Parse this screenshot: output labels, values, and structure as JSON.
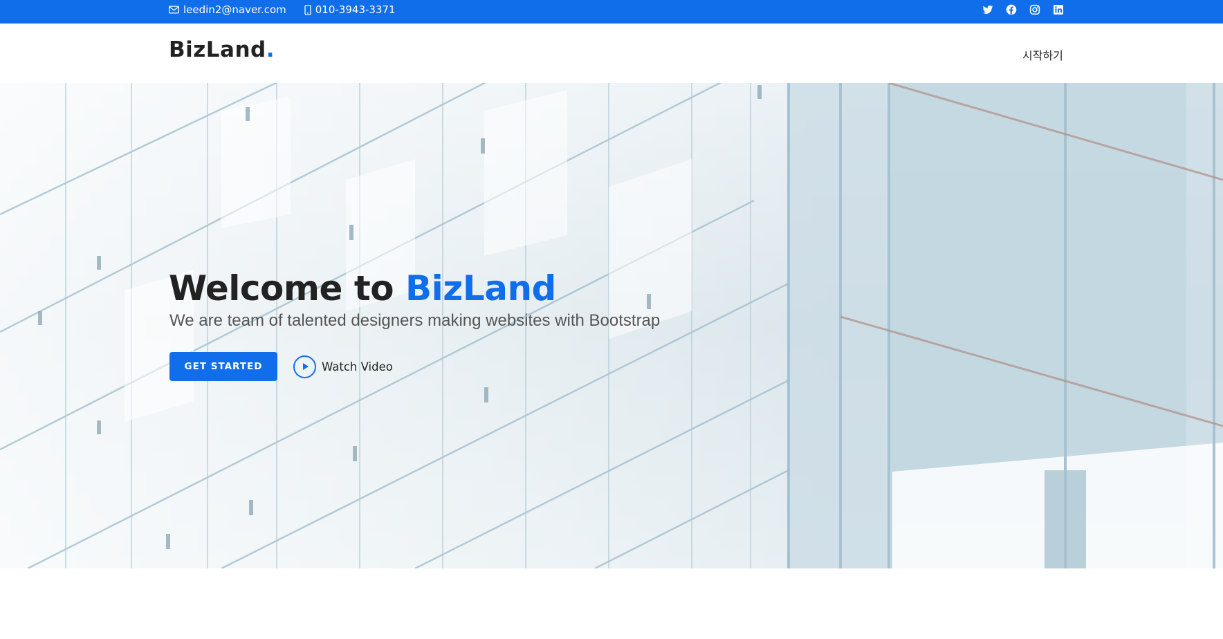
{
  "topbar": {
    "email": "leedin2@naver.com",
    "phone": "010-3943-3371",
    "social": [
      "twitter-icon",
      "facebook-icon",
      "instagram-icon",
      "linkedin-icon"
    ]
  },
  "header": {
    "logo_text": "BizLand",
    "logo_dot": ".",
    "nav_link": "시작하기"
  },
  "hero": {
    "title_prefix": "Welcome to ",
    "title_brand": "BizLand",
    "subtitle": "We are team of talented designers making websites with Bootstrap",
    "cta_label": "GET STARTED",
    "video_label": "Watch Video"
  },
  "colors": {
    "accent": "#106eea",
    "text_dark": "#222222",
    "text_muted": "#555555"
  }
}
